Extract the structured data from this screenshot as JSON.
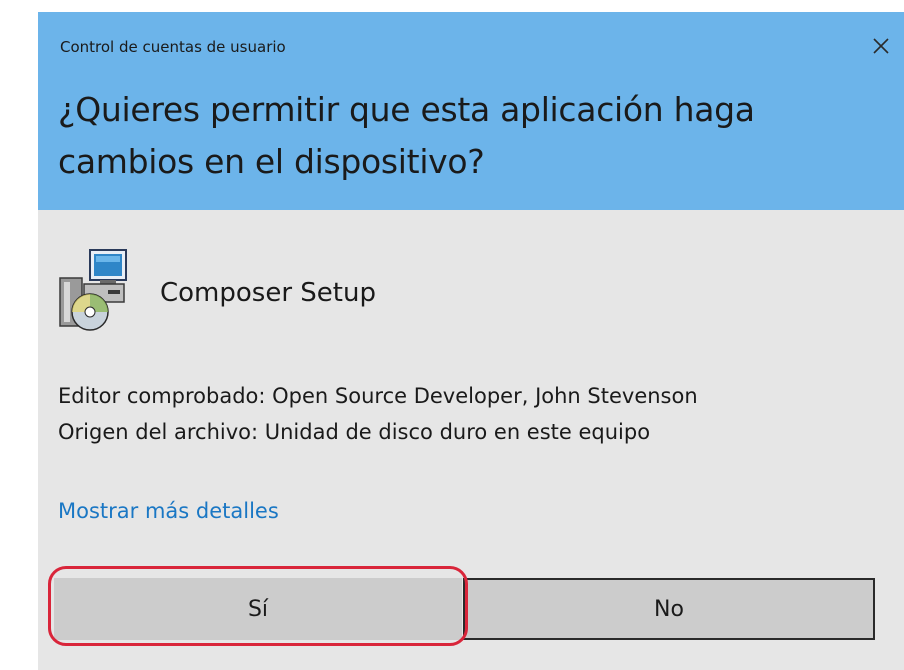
{
  "header": {
    "window_title": "Control de cuentas de usuario",
    "question": "¿Quieres permitir que esta aplicación haga cambios en el dispositivo?",
    "close_icon": "close-icon",
    "background_color": "#6cb4ea"
  },
  "app": {
    "name": "Composer Setup",
    "icon": "installer-icon"
  },
  "info": {
    "publisher": "Editor comprobado: Open Source Developer, John Stevenson",
    "origin": "Origen del archivo: Unidad de disco duro en este equipo"
  },
  "details_link": "Mostrar más detalles",
  "buttons": {
    "yes_label": "Sí",
    "no_label": "No"
  },
  "annotation": {
    "highlight_color": "#d9253a",
    "highlight_target": "yes-button"
  }
}
